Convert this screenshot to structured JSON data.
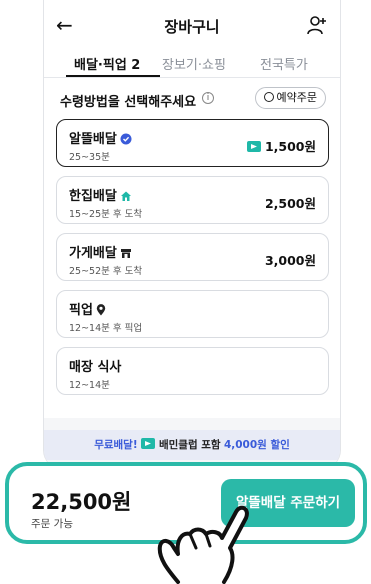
{
  "header": {
    "title": "장바구니"
  },
  "tabs": [
    {
      "label": "배달·픽업 2",
      "active": true
    },
    {
      "label": "장보기·쇼핑",
      "active": false
    },
    {
      "label": "전국특가",
      "active": false
    }
  ],
  "section": {
    "heading": "수령방법을 선택해주세요",
    "info_icon": "ⓘ",
    "reserve_label": "예약주문"
  },
  "options": [
    {
      "name": "알뜰배달",
      "time": "25~35분",
      "price": "1,500원",
      "selected": true,
      "icon": "verified-badge-icon"
    },
    {
      "name": "한집배달",
      "time": "15~25분 후 도착",
      "price": "2,500원",
      "selected": false,
      "icon": "house-icon"
    },
    {
      "name": "가게배달",
      "time": "25~52분 후 도착",
      "price": "3,000원",
      "selected": false,
      "icon": "store-icon"
    },
    {
      "name": "픽업",
      "time": "12~14분 후 픽업",
      "price": "",
      "selected": false,
      "icon": "location-pin-icon"
    },
    {
      "name": "매장 식사",
      "time": "12~14분",
      "price": "",
      "selected": false,
      "icon": ""
    }
  ],
  "promo": {
    "part1": "무료배달!",
    "part2": "배민클럽 포함",
    "part3": "4,000원 할인"
  },
  "bottom": {
    "total": "22,500원",
    "status": "주문 가능",
    "order_label": "알뜰배달 주문하기"
  },
  "colors": {
    "accent": "#2bb9a8",
    "promo_blue": "#3a5bd9",
    "promo_bg": "#e8ebf6"
  }
}
